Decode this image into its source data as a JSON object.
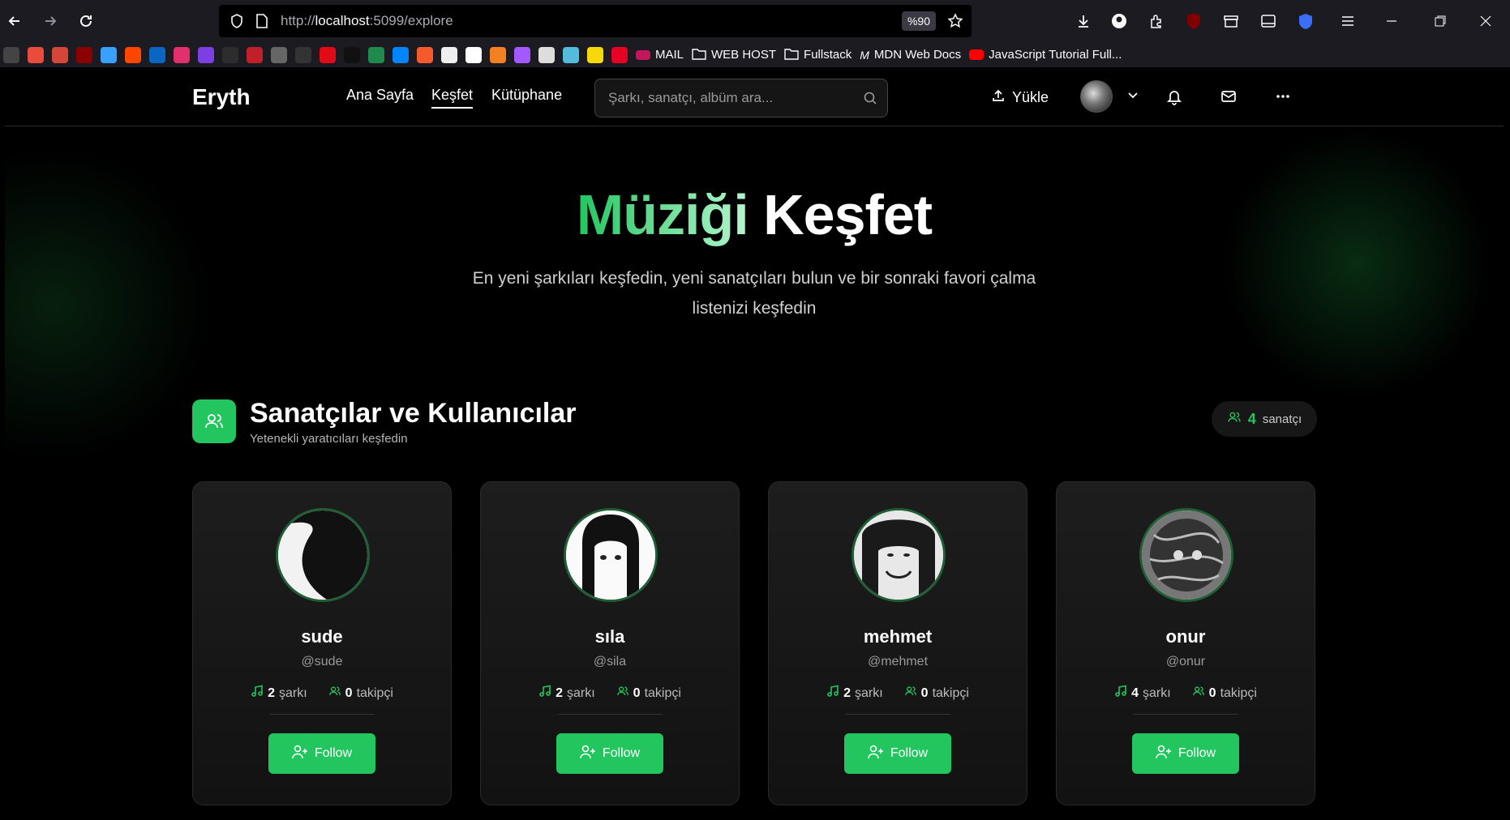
{
  "browser": {
    "url_prefix": "http://",
    "url_host": "localhost",
    "url_rest": ":5099/explore",
    "zoom": "%90",
    "bookmarks": [
      "MAIL",
      "WEB HOST",
      "Fullstack",
      "MDN Web Docs",
      "JavaScript Tutorial Full..."
    ]
  },
  "nav": {
    "logo": "Eryth",
    "links": [
      "Ana Sayfa",
      "Keşfet",
      "Kütüphane"
    ],
    "search_placeholder": "Şarkı, sanatçı, albüm ara...",
    "upload_label": "Yükle"
  },
  "hero": {
    "title_highlight": "Müziği",
    "title_rest": "Keşfet",
    "subtitle": "En yeni şarkıları keşfedin, yeni sanatçıları bulun ve bir sonraki favori çalma listenizi keşfedin"
  },
  "section": {
    "title": "Sanatçılar ve Kullanıcılar",
    "subtitle": "Yetenekli yaratıcıları keşfedin",
    "count": "4",
    "count_label": "sanatçı"
  },
  "artists": [
    {
      "name": "sude",
      "handle": "@sude",
      "songs": "2",
      "songs_label": "şarkı",
      "followers": "0",
      "followers_label": "takipçi",
      "follow_label": "Follow"
    },
    {
      "name": "sıla",
      "handle": "@sila",
      "songs": "2",
      "songs_label": "şarkı",
      "followers": "0",
      "followers_label": "takipçi",
      "follow_label": "Follow"
    },
    {
      "name": "mehmet",
      "handle": "@mehmet",
      "songs": "2",
      "songs_label": "şarkı",
      "followers": "0",
      "followers_label": "takipçi",
      "follow_label": "Follow"
    },
    {
      "name": "onur",
      "handle": "@onur",
      "songs": "4",
      "songs_label": "şarkı",
      "followers": "0",
      "followers_label": "takipçi",
      "follow_label": "Follow"
    }
  ],
  "colors": {
    "accent": "#22c55e",
    "background": "#000000",
    "card": "#1d1d1d"
  }
}
